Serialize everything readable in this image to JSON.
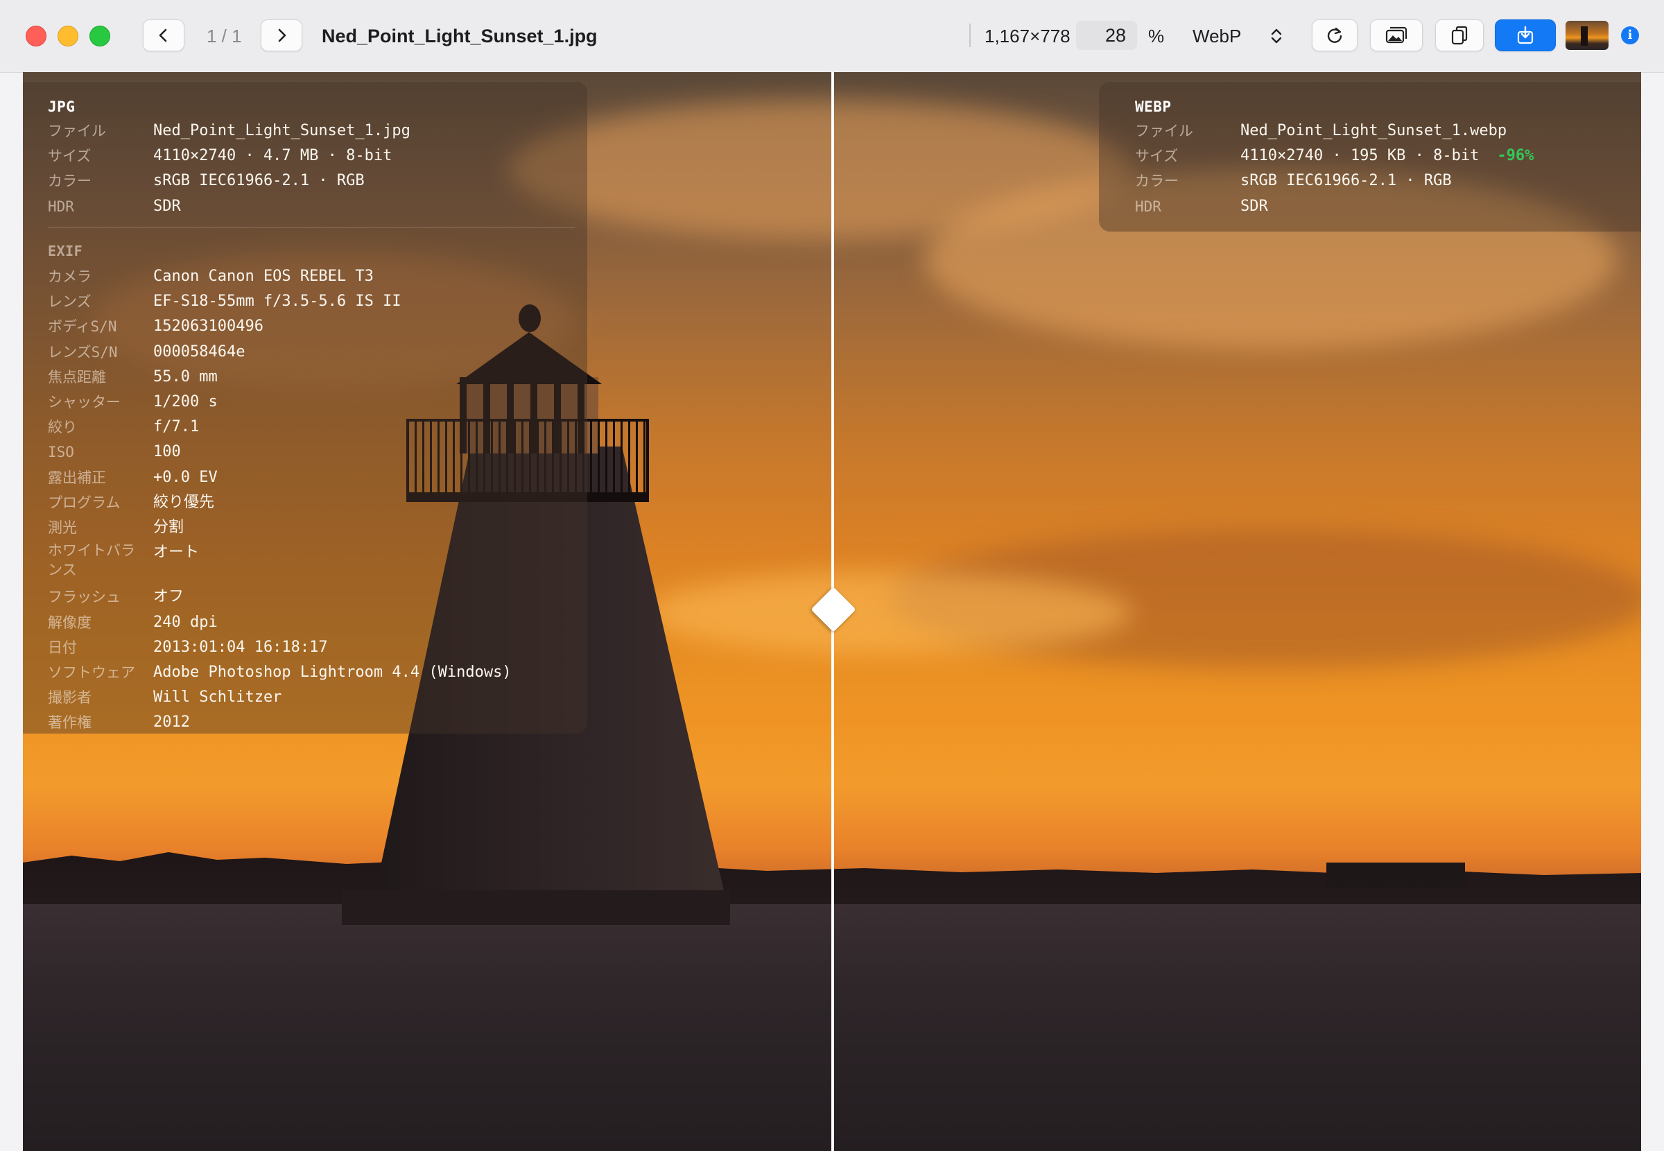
{
  "window": {
    "title": "Ned_Point_Light_Sunset_1.jpg",
    "counter": "1 / 1",
    "dimensions": "1,167×778",
    "zoom_value": "28",
    "zoom_unit": "%",
    "format": "WebP"
  },
  "toolbar_icons": {
    "prev": "chevron-left-icon",
    "next": "chevron-right-icon",
    "format_stepper": "chevron-updown-icon",
    "rotate": "rotate-icon",
    "gallery": "photos-icon",
    "copy": "copy-icon",
    "export": "download-icon",
    "info": "info-icon"
  },
  "colors": {
    "accent": "#1479f5",
    "delta_positive": "#34c759",
    "close": "#fe5f57",
    "minimize": "#febc2e",
    "maximize": "#28c840"
  },
  "left_panel": {
    "header": "JPG",
    "rows": [
      {
        "label": "ファイル",
        "value": "Ned_Point_Light_Sunset_1.jpg"
      },
      {
        "label": "サイズ",
        "value": "4110×2740 · 4.7 MB · 8-bit"
      },
      {
        "label": "カラー",
        "value": "sRGB IEC61966-2.1 · RGB"
      },
      {
        "label": "HDR",
        "value": "SDR"
      }
    ],
    "exif_header": "EXIF",
    "exif": [
      {
        "label": "カメラ",
        "value": "Canon Canon EOS REBEL T3"
      },
      {
        "label": "レンズ",
        "value": "EF-S18-55mm f/3.5-5.6 IS II"
      },
      {
        "label": "ボディS/N",
        "value": "152063100496"
      },
      {
        "label": "レンズS/N",
        "value": "000058464e"
      },
      {
        "label": "焦点距離",
        "value": "55.0 mm"
      },
      {
        "label": "シャッター",
        "value": "1/200 s"
      },
      {
        "label": "絞り",
        "value": "f/7.1"
      },
      {
        "label": "ISO",
        "value": "100"
      },
      {
        "label": "露出補正",
        "value": "+0.0 EV"
      },
      {
        "label": "プログラム",
        "value": "絞り優先"
      },
      {
        "label": "測光",
        "value": "分割"
      },
      {
        "label": "ホワイトバランス",
        "value": "オート"
      },
      {
        "label": "フラッシュ",
        "value": "オフ"
      },
      {
        "label": "解像度",
        "value": "240 dpi"
      },
      {
        "label": "日付",
        "value": "2013:01:04 16:18:17"
      },
      {
        "label": "ソフトウェア",
        "value": "Adobe Photoshop Lightroom 4.4 (Windows)"
      },
      {
        "label": "撮影者",
        "value": "Will Schlitzer"
      },
      {
        "label": "著作権",
        "value": "2012"
      }
    ]
  },
  "right_panel": {
    "header": "WEBP",
    "rows": [
      {
        "label": "ファイル",
        "value": "Ned_Point_Light_Sunset_1.webp"
      },
      {
        "label": "サイズ",
        "value": "4110×2740 · 195 KB · 8-bit",
        "delta": "-96%"
      },
      {
        "label": "カラー",
        "value": "sRGB IEC61966-2.1 · RGB"
      },
      {
        "label": "HDR",
        "value": "SDR"
      }
    ]
  }
}
